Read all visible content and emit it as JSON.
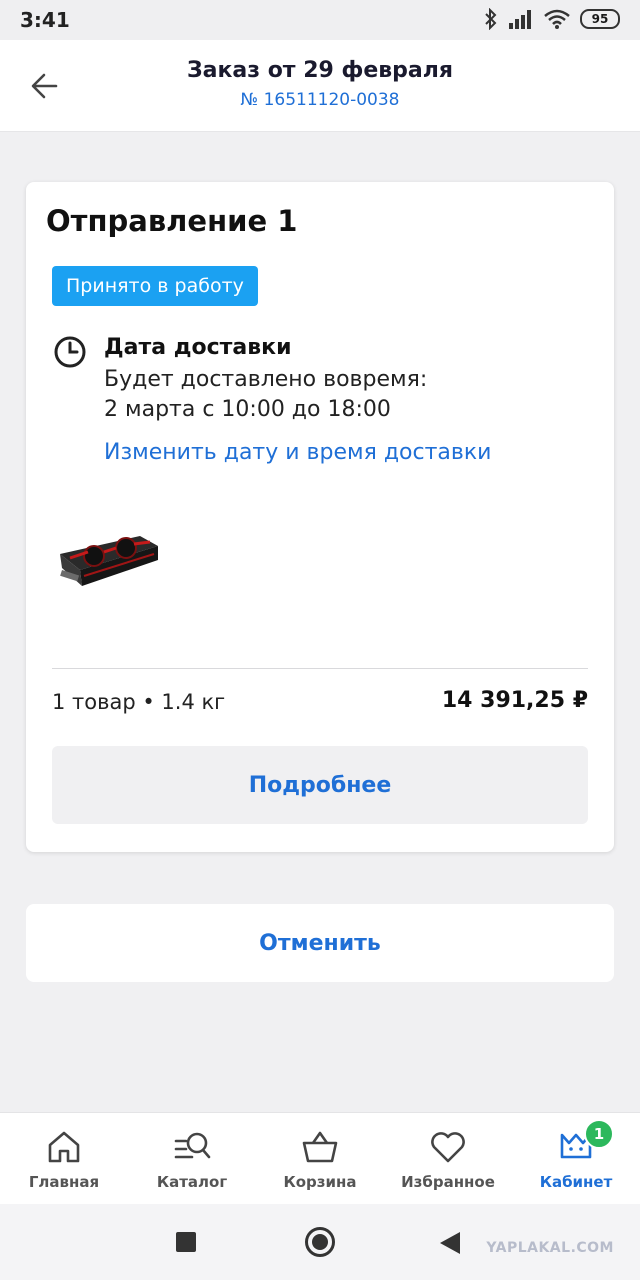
{
  "status_bar": {
    "time": "3:41",
    "battery": "95",
    "icons": [
      "bluetooth-icon",
      "signal-icon",
      "wifi-icon",
      "battery-icon"
    ]
  },
  "header": {
    "title": "Заказ от 29 февраля",
    "order_number": "№ 16511120-0038"
  },
  "shipment": {
    "title": "Отправление 1",
    "status": "Принято в работу",
    "delivery_label": "Дата доставки",
    "delivery_line1": "Будет доставлено вовремя:",
    "delivery_line2": "2 марта с 10:00 до 18:00",
    "change_link": "Изменить дату и время доставки",
    "summary": "1 товар • 1.4 кг",
    "price": "14 391,25 ₽",
    "details_button": "Подробнее"
  },
  "cancel_button": "Отменить",
  "bottom_nav": {
    "items": [
      {
        "label": "Главная",
        "icon": "home-icon"
      },
      {
        "label": "Каталог",
        "icon": "catalog-search-icon"
      },
      {
        "label": "Корзина",
        "icon": "basket-icon"
      },
      {
        "label": "Избранное",
        "icon": "heart-icon"
      },
      {
        "label": "Кабинет",
        "icon": "crown-icon",
        "active": true,
        "badge": "1"
      }
    ]
  },
  "watermark": "YAPLAKAL.COM",
  "colors": {
    "accent": "#1f6fd6",
    "status_chip": "#1ba1f2",
    "badge": "#2cb85c",
    "background": "#f0f0f2"
  }
}
